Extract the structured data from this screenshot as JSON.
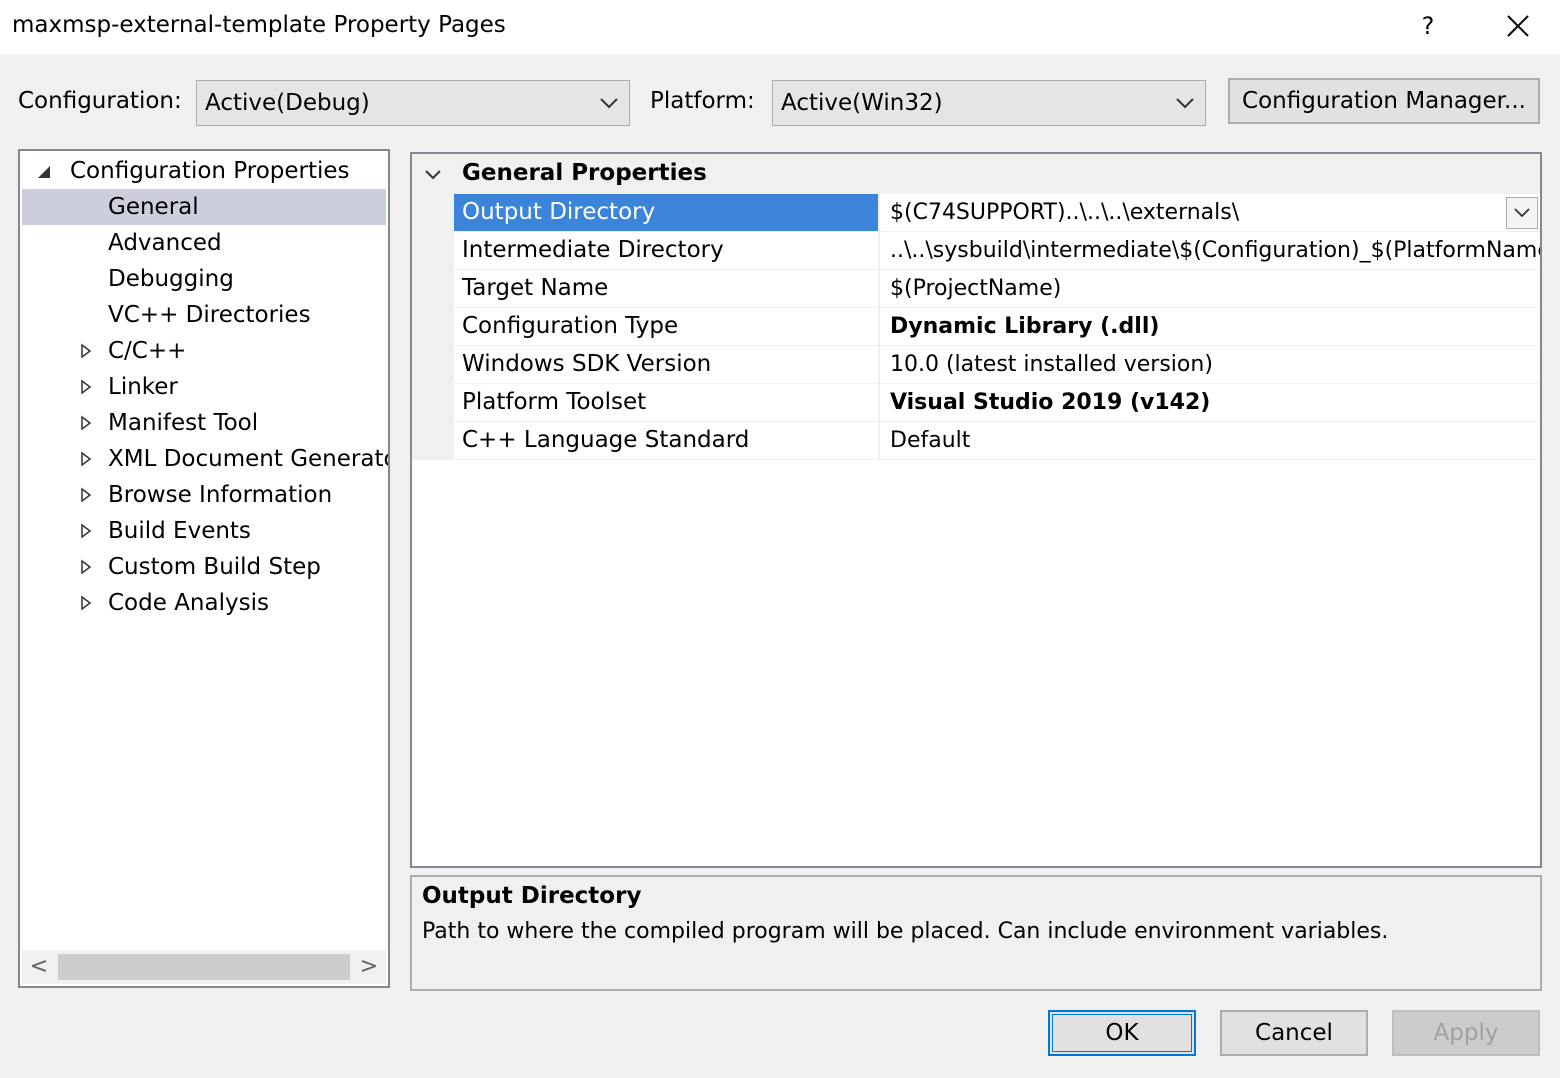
{
  "window": {
    "title": "maxmsp-external-template Property Pages",
    "help_label": "?"
  },
  "toolbar": {
    "configuration_label": "Configuration:",
    "configuration_value": "Active(Debug)",
    "platform_label": "Platform:",
    "platform_value": "Active(Win32)",
    "config_manager_label": "Configuration Manager..."
  },
  "tree": {
    "root": "Configuration Properties",
    "items": [
      {
        "label": "General",
        "expandable": false,
        "selected": true
      },
      {
        "label": "Advanced",
        "expandable": false
      },
      {
        "label": "Debugging",
        "expandable": false
      },
      {
        "label": "VC++ Directories",
        "expandable": false
      },
      {
        "label": "C/C++",
        "expandable": true
      },
      {
        "label": "Linker",
        "expandable": true
      },
      {
        "label": "Manifest Tool",
        "expandable": true
      },
      {
        "label": "XML Document Generator",
        "expandable": true
      },
      {
        "label": "Browse Information",
        "expandable": true
      },
      {
        "label": "Build Events",
        "expandable": true
      },
      {
        "label": "Custom Build Step",
        "expandable": true
      },
      {
        "label": "Code Analysis",
        "expandable": true
      }
    ],
    "scroll_left": "<",
    "scroll_right": ">"
  },
  "grid": {
    "category": "General Properties",
    "rows": [
      {
        "name": "Output Directory",
        "value": "$(C74SUPPORT)..\\..\\..\\externals\\",
        "bold": false,
        "selected": true
      },
      {
        "name": "Intermediate Directory",
        "value": "..\\..\\sysbuild\\intermediate\\$(Configuration)_$(PlatformName)",
        "bold": false
      },
      {
        "name": "Target Name",
        "value": "$(ProjectName)",
        "bold": false
      },
      {
        "name": "Configuration Type",
        "value": "Dynamic Library (.dll)",
        "bold": true
      },
      {
        "name": "Windows SDK Version",
        "value": "10.0 (latest installed version)",
        "bold": false
      },
      {
        "name": "Platform Toolset",
        "value": "Visual Studio 2019 (v142)",
        "bold": true
      },
      {
        "name": "C++ Language Standard",
        "value": "Default",
        "bold": false
      }
    ]
  },
  "description": {
    "title": "Output Directory",
    "text": "Path to where the compiled program will be placed. Can include environment variables."
  },
  "footer": {
    "ok_label": "OK",
    "cancel_label": "Cancel",
    "apply_label": "Apply"
  },
  "colors": {
    "selection_blue": "#3b84d9",
    "tree_selection": "#cccedb",
    "dialog_bg": "#f0f0f0"
  }
}
